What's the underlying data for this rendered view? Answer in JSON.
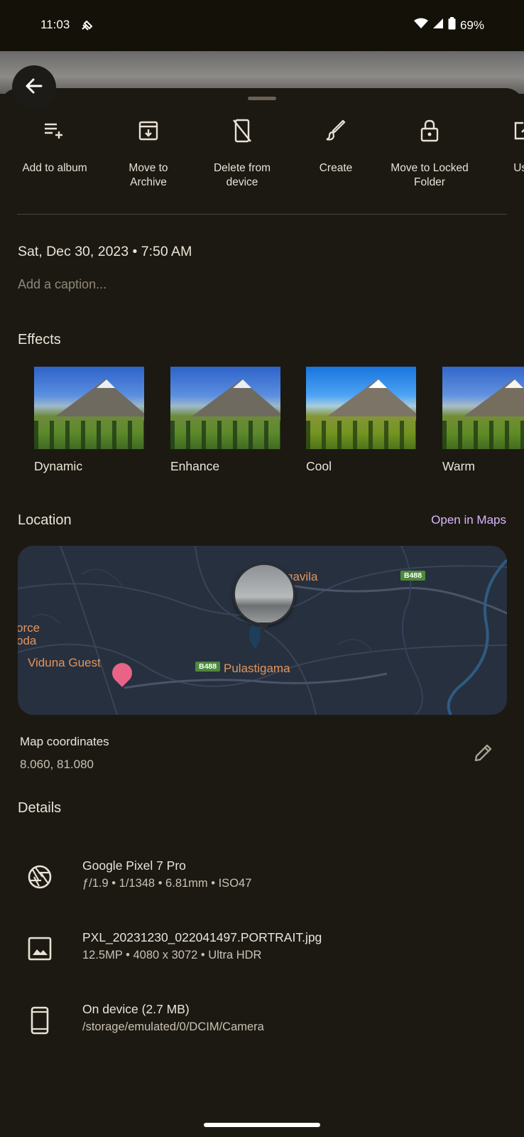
{
  "status_bar": {
    "time": "11:03",
    "battery": "69%",
    "icons": [
      "cast-icon",
      "wifi-icon",
      "signal-icon",
      "battery-icon"
    ]
  },
  "back_icon": "arrow-left-icon",
  "actions": [
    {
      "label": "Add to album",
      "icon": "playlist-add-icon"
    },
    {
      "label": "Move to Archive",
      "icon": "archive-icon"
    },
    {
      "label": "Delete from device",
      "icon": "phone-off-icon"
    },
    {
      "label": "Create",
      "icon": "brush-icon"
    },
    {
      "label": "Move to Locked Folder",
      "icon": "lock-icon"
    },
    {
      "label": "Use",
      "icon": "open-external-icon"
    }
  ],
  "info": {
    "date": "Sat, Dec 30, 2023 • 7:50 AM",
    "caption_placeholder": "Add a caption..."
  },
  "effects": {
    "title": "Effects",
    "items": [
      "Dynamic",
      "Enhance",
      "Cool",
      "Warm"
    ]
  },
  "location": {
    "title": "Location",
    "open_in_maps": "Open in Maps",
    "map": {
      "labels": {
        "gavila": "gavila",
        "orce": "orce",
        "oda": "oda",
        "viduna": "Viduna Guest",
        "pulastigama": "Pulastigama"
      },
      "road_badges": [
        "B488",
        "B488"
      ]
    },
    "coordinates_title": "Map coordinates",
    "coordinates_value": "8.060, 81.080"
  },
  "details": {
    "title": "Details",
    "rows": [
      {
        "title": "Google Pixel 7 Pro",
        "sub": "ƒ/1.9 • 1/1348 • 6.81mm • ISO47",
        "icon": "camera-shutter-icon"
      },
      {
        "title": "PXL_20231230_022041497.PORTRAIT.jpg",
        "sub": "12.5MP • 4080 x 3072 • Ultra HDR",
        "icon": "image-icon"
      },
      {
        "title": "On device (2.7 MB)",
        "sub": "/storage/emulated/0/DCIM/Camera",
        "icon": "smartphone-icon"
      }
    ]
  },
  "colors": {
    "background": "#1c1913",
    "accent_link": "#d7b8ff",
    "map_label": "#e2955a",
    "map_background": "#27303f"
  }
}
